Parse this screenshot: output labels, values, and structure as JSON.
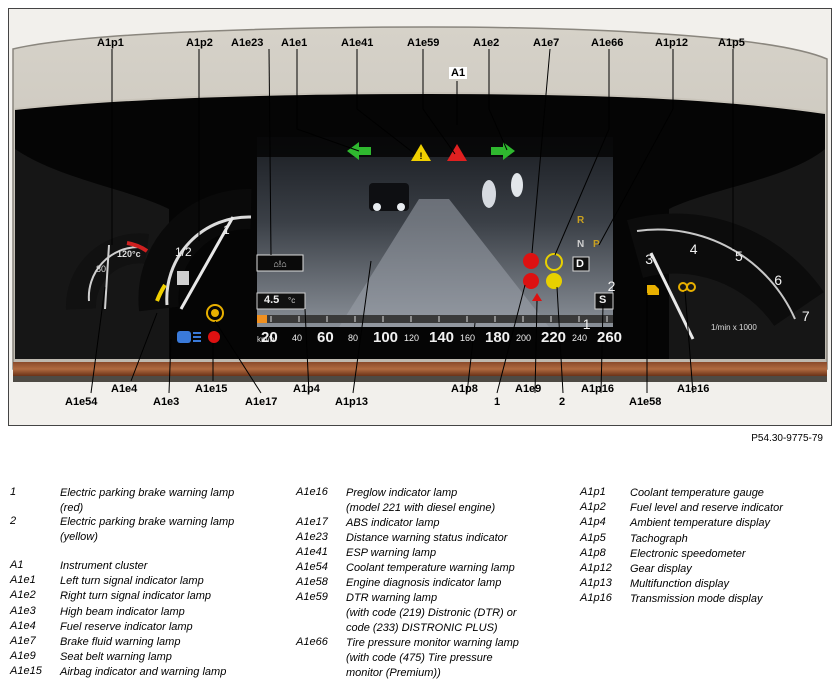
{
  "figure_id": "P54.30-9775-79",
  "callouts": {
    "A1p1": "A1p1",
    "A1p2": "A1p2",
    "A1e23": "A1e23",
    "A1e1": "A1e1",
    "A1e41": "A1e41",
    "A1e59": "A1e59",
    "A1e2": "A1e2",
    "A1e7": "A1e7",
    "A1e66": "A1e66",
    "A1p12": "A1p12",
    "A1p5": "A1p5",
    "A1": "A1",
    "A1e54": "A1e54",
    "A1e4": "A1e4",
    "A1e3": "A1e3",
    "A1e15": "A1e15",
    "A1e17": "A1e17",
    "A1p4": "A1p4",
    "A1p13": "A1p13",
    "A1p8": "A1p8",
    "n1": "1",
    "A1e9": "A1e9",
    "n2": "2",
    "A1p16": "A1p16",
    "A1e58": "A1e58",
    "A1e16": "A1e16"
  },
  "cluster": {
    "coolant_max": "120°c",
    "coolant_mid": "80",
    "fuel_half": "1/2",
    "fuel_full": "1",
    "ambient_temp": "4.5",
    "ambient_unit": "°c",
    "transmission_mode": "S",
    "gear_r": "R",
    "gear_n": "N",
    "gear_p": "P",
    "gear_d": "D",
    "tacho_unit": "1/min x 1000",
    "tacho_ticks": [
      "1",
      "2",
      "3",
      "4",
      "5",
      "6",
      "7"
    ],
    "speedo_unit": "km/h",
    "speedo_ticks": [
      "20",
      "40",
      "60",
      "80",
      "100",
      "120",
      "140",
      "160",
      "180",
      "200",
      "220",
      "240",
      "260"
    ]
  },
  "legend": {
    "col1": [
      {
        "code": "1",
        "desc": "Electric parking brake warning lamp\n(red)"
      },
      {
        "code": "2",
        "desc": "Electric parking brake warning lamp\n(yellow)"
      },
      {
        "code": "A1",
        "desc": "Instrument cluster"
      },
      {
        "code": "A1e1",
        "desc": "Left turn signal indicator lamp"
      },
      {
        "code": "A1e2",
        "desc": "Right turn signal indicator lamp"
      },
      {
        "code": "A1e3",
        "desc": "High beam indicator lamp"
      },
      {
        "code": "A1e4",
        "desc": "Fuel reserve indicator lamp"
      },
      {
        "code": "A1e7",
        "desc": "Brake fluid warning lamp"
      },
      {
        "code": "A1e9",
        "desc": "Seat belt warning lamp"
      },
      {
        "code": "A1e15",
        "desc": "Airbag indicator and warning lamp"
      }
    ],
    "col2": [
      {
        "code": "A1e16",
        "desc": "Preglow indicator lamp\n(model 221 with diesel engine)"
      },
      {
        "code": "A1e17",
        "desc": "ABS indicator lamp"
      },
      {
        "code": "A1e23",
        "desc": "Distance warning status indicator"
      },
      {
        "code": "A1e41",
        "desc": "ESP warning lamp"
      },
      {
        "code": "A1e54",
        "desc": "Coolant temperature warning lamp"
      },
      {
        "code": "A1e58",
        "desc": "Engine diagnosis indicator lamp"
      },
      {
        "code": "A1e59",
        "desc": "DTR warning lamp\n(with code (219) Distronic (DTR) or\ncode (233) DISTRONIC PLUS)"
      },
      {
        "code": "A1e66",
        "desc": "Tire pressure monitor warning lamp\n(with code (475) Tire pressure\nmonitor (Premium))"
      }
    ],
    "col3": [
      {
        "code": "A1p1",
        "desc": "Coolant temperature gauge"
      },
      {
        "code": "A1p2",
        "desc": "Fuel level and reserve indicator"
      },
      {
        "code": "A1p4",
        "desc": "Ambient temperature display"
      },
      {
        "code": "A1p5",
        "desc": "Tachograph"
      },
      {
        "code": "A1p8",
        "desc": "Electronic speedometer"
      },
      {
        "code": "A1p12",
        "desc": "Gear display"
      },
      {
        "code": "A1p13",
        "desc": "Multifunction display"
      },
      {
        "code": "A1p16",
        "desc": "Transmission mode display"
      }
    ]
  }
}
